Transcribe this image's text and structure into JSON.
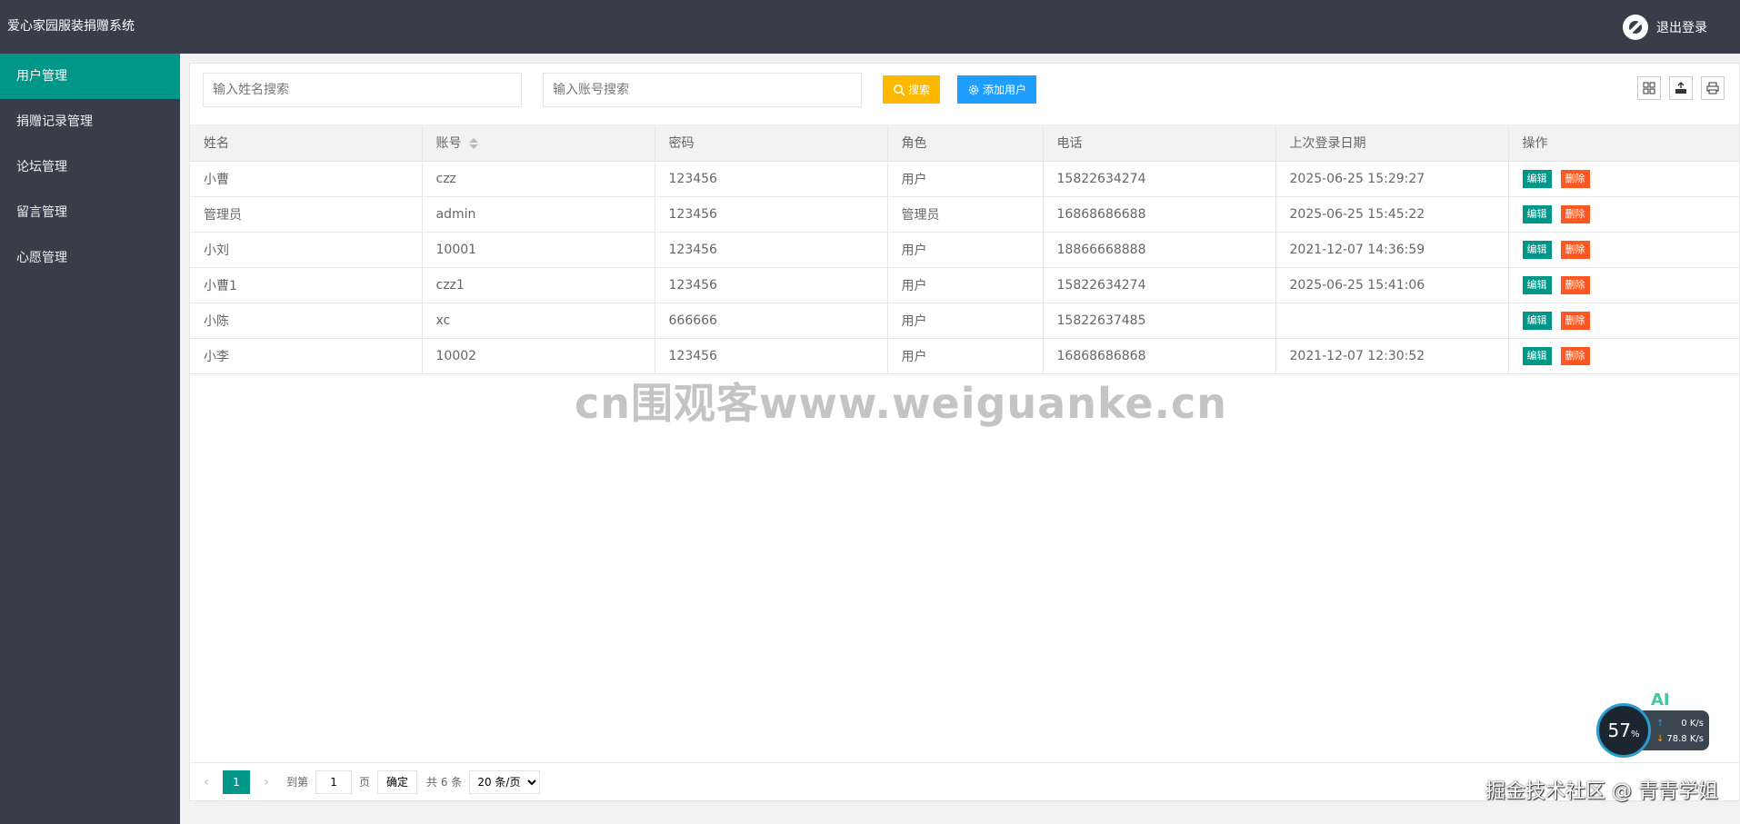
{
  "header": {
    "title": "爱心家园服装捐赠系统",
    "logout_label": "退出登录"
  },
  "sidebar": {
    "items": [
      {
        "label": "用户管理"
      },
      {
        "label": "捐赠记录管理"
      },
      {
        "label": "论坛管理"
      },
      {
        "label": "留言管理"
      },
      {
        "label": "心愿管理"
      }
    ]
  },
  "toolbar": {
    "name_search_placeholder": "输入姓名搜索",
    "account_search_placeholder": "输入账号搜索",
    "search_label": "搜索",
    "add_user_label": "添加用户"
  },
  "table": {
    "columns": [
      "姓名",
      "账号",
      "密码",
      "角色",
      "电话",
      "上次登录日期",
      "操作"
    ],
    "rows": [
      {
        "name": "小曹",
        "account": "czz",
        "password": "123456",
        "role": "用户",
        "phone": "15822634274",
        "last_login": "2025-06-25 15:29:27"
      },
      {
        "name": "管理员",
        "account": "admin",
        "password": "123456",
        "role": "管理员",
        "phone": "16868686688",
        "last_login": "2025-06-25 15:45:22"
      },
      {
        "name": "小刘",
        "account": "10001",
        "password": "123456",
        "role": "用户",
        "phone": "18866668888",
        "last_login": "2021-12-07 14:36:59"
      },
      {
        "name": "小曹1",
        "account": "czz1",
        "password": "123456",
        "role": "用户",
        "phone": "15822634274",
        "last_login": "2025-06-25 15:41:06"
      },
      {
        "name": "小陈",
        "account": "xc",
        "password": "666666",
        "role": "用户",
        "phone": "15822637485",
        "last_login": ""
      },
      {
        "name": "小李",
        "account": "10002",
        "password": "123456",
        "role": "用户",
        "phone": "16868686868",
        "last_login": "2021-12-07 12:30:52"
      }
    ],
    "edit_label": "编辑",
    "delete_label": "删除"
  },
  "watermark": "cn围观客www.weiguanke.cn",
  "pager": {
    "current_page": "1",
    "goto_label": "到第",
    "page_label": "页",
    "goto_value": "1",
    "confirm_label": "确定",
    "total_label": "共 6 条",
    "page_size_option": "20 条/页"
  },
  "net_widget": {
    "percent": "57",
    "percent_unit": "%",
    "upload": "0",
    "upload_unit": "K/s",
    "download": "78.8",
    "download_unit": "K/s",
    "ai_label": "AI"
  },
  "footer_mark": "掘金技术社区 @ 青青学姐",
  "colors": {
    "header_bg": "#393d49",
    "active_nav": "#009688",
    "search_btn": "#ffb800",
    "add_btn": "#1e9fff",
    "delete_btn": "#ff5722",
    "admin_role": "#cc0000"
  }
}
